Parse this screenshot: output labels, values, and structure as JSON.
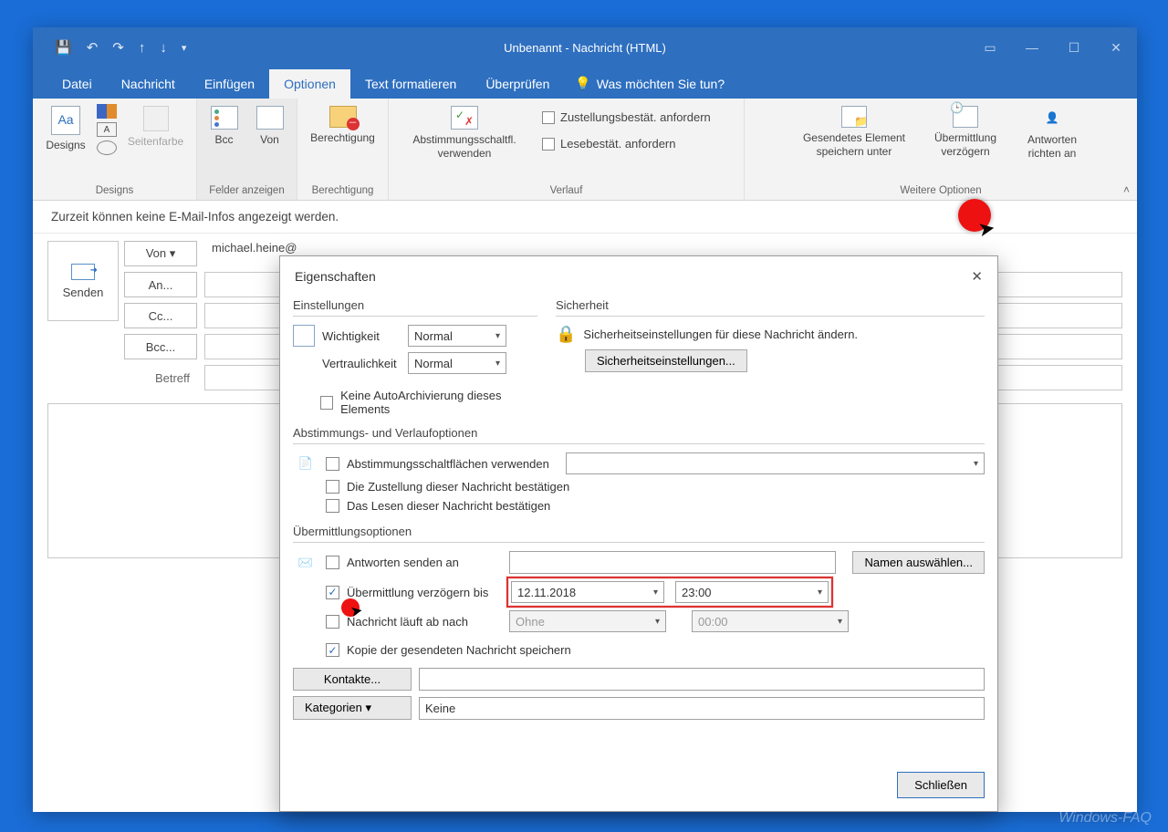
{
  "title": "Unbenannt  -  Nachricht (HTML)",
  "tabs": {
    "datei": "Datei",
    "nachricht": "Nachricht",
    "einfuegen": "Einfügen",
    "optionen": "Optionen",
    "textform": "Text formatieren",
    "ueberpruefen": "Überprüfen",
    "tellme": "Was möchten Sie tun?"
  },
  "ribbon": {
    "designs": {
      "btn": "Designs",
      "seitenfarbe": "Seitenfarbe",
      "group": "Designs"
    },
    "felder": {
      "bcc": "Bcc",
      "von": "Von",
      "group": "Felder anzeigen"
    },
    "berechtigung": {
      "btn": "Berechtigung",
      "group": "Berechtigung"
    },
    "verlauf": {
      "abst": "Abstimmungsschaltfl.\nverwenden",
      "zustell": "Zustellungsbestät. anfordern",
      "lese": "Lesebestät. anfordern",
      "group": "Verlauf"
    },
    "weitere": {
      "gesendet": "Gesendetes Element\nspeichern unter",
      "verzoegern": "Übermittlung\nverzögern",
      "antworten": "Antworten\nrichten an",
      "group": "Weitere Optionen"
    }
  },
  "infobar": "Zurzeit können keine E-Mail-Infos angezeigt werden.",
  "compose": {
    "send": "Senden",
    "von": "Von ▾",
    "an": "An...",
    "cc": "Cc...",
    "bcc": "Bcc...",
    "betreff": "Betreff",
    "from_value": "michael.heine@"
  },
  "dialog": {
    "title": "Eigenschaften",
    "einstellungen": "Einstellungen",
    "wichtigkeit": "Wichtigkeit",
    "wichtigkeit_val": "Normal",
    "vertraulichkeit": "Vertraulichkeit",
    "vertraulichkeit_val": "Normal",
    "noarchive": "Keine AutoArchivierung dieses Elements",
    "sicherheit": "Sicherheit",
    "sich_text": "Sicherheitseinstellungen für diese Nachricht ändern.",
    "sich_btn": "Sicherheitseinstellungen...",
    "abst_group": "Abstimmungs- und Verlaufoptionen",
    "abst1": "Abstimmungsschaltflächen verwenden",
    "abst2": "Die Zustellung dieser Nachricht bestätigen",
    "abst3": "Das Lesen dieser Nachricht bestätigen",
    "ueberm_group": "Übermittlungsoptionen",
    "antw_senden": "Antworten senden an",
    "namen_btn": "Namen auswählen...",
    "verz_bis": "Übermittlung verzögern bis",
    "verz_date": "12.11.2018",
    "verz_time": "23:00",
    "ablauf": "Nachricht läuft ab nach",
    "ablauf_date": "Ohne",
    "ablauf_time": "00:00",
    "kopie": "Kopie der gesendeten Nachricht speichern",
    "kontakte": "Kontakte...",
    "kategorien": "Kategorien   ▾",
    "kat_val": "Keine",
    "close": "Schließen"
  },
  "watermark": "Windows-FAQ"
}
